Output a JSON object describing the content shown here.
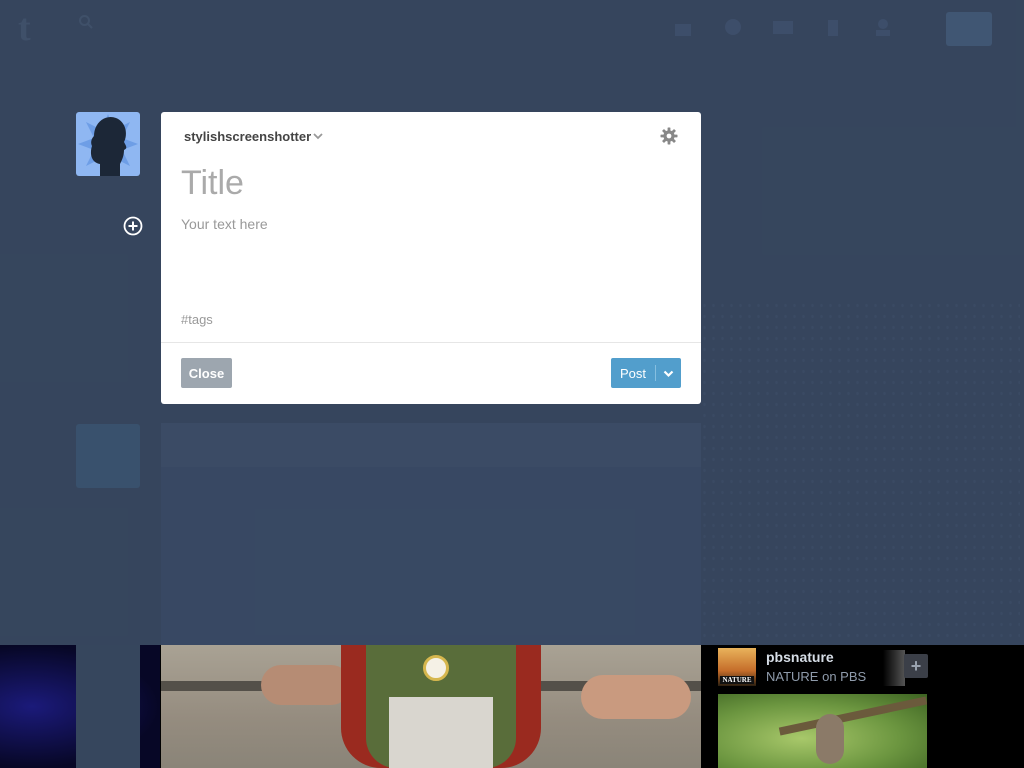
{
  "compose": {
    "blog_name": "stylishscreenshotter",
    "title_placeholder": "Title",
    "body_placeholder": "Your text here",
    "tags_placeholder": "#tags",
    "close_label": "Close",
    "post_label": "Post"
  },
  "recommended": {
    "name": "pbsnature",
    "subtitle": "NATURE on PBS",
    "thumb_text": "NATURE",
    "follow_symbol": "+"
  },
  "colors": {
    "background": "#36465d",
    "post_button": "#529ecc",
    "close_button": "#9da6af"
  },
  "icons": {
    "logo": "tumblr-logo-icon",
    "settings": "gear-icon",
    "add": "plus-circle-icon",
    "dropdown": "chevron-down-icon"
  }
}
